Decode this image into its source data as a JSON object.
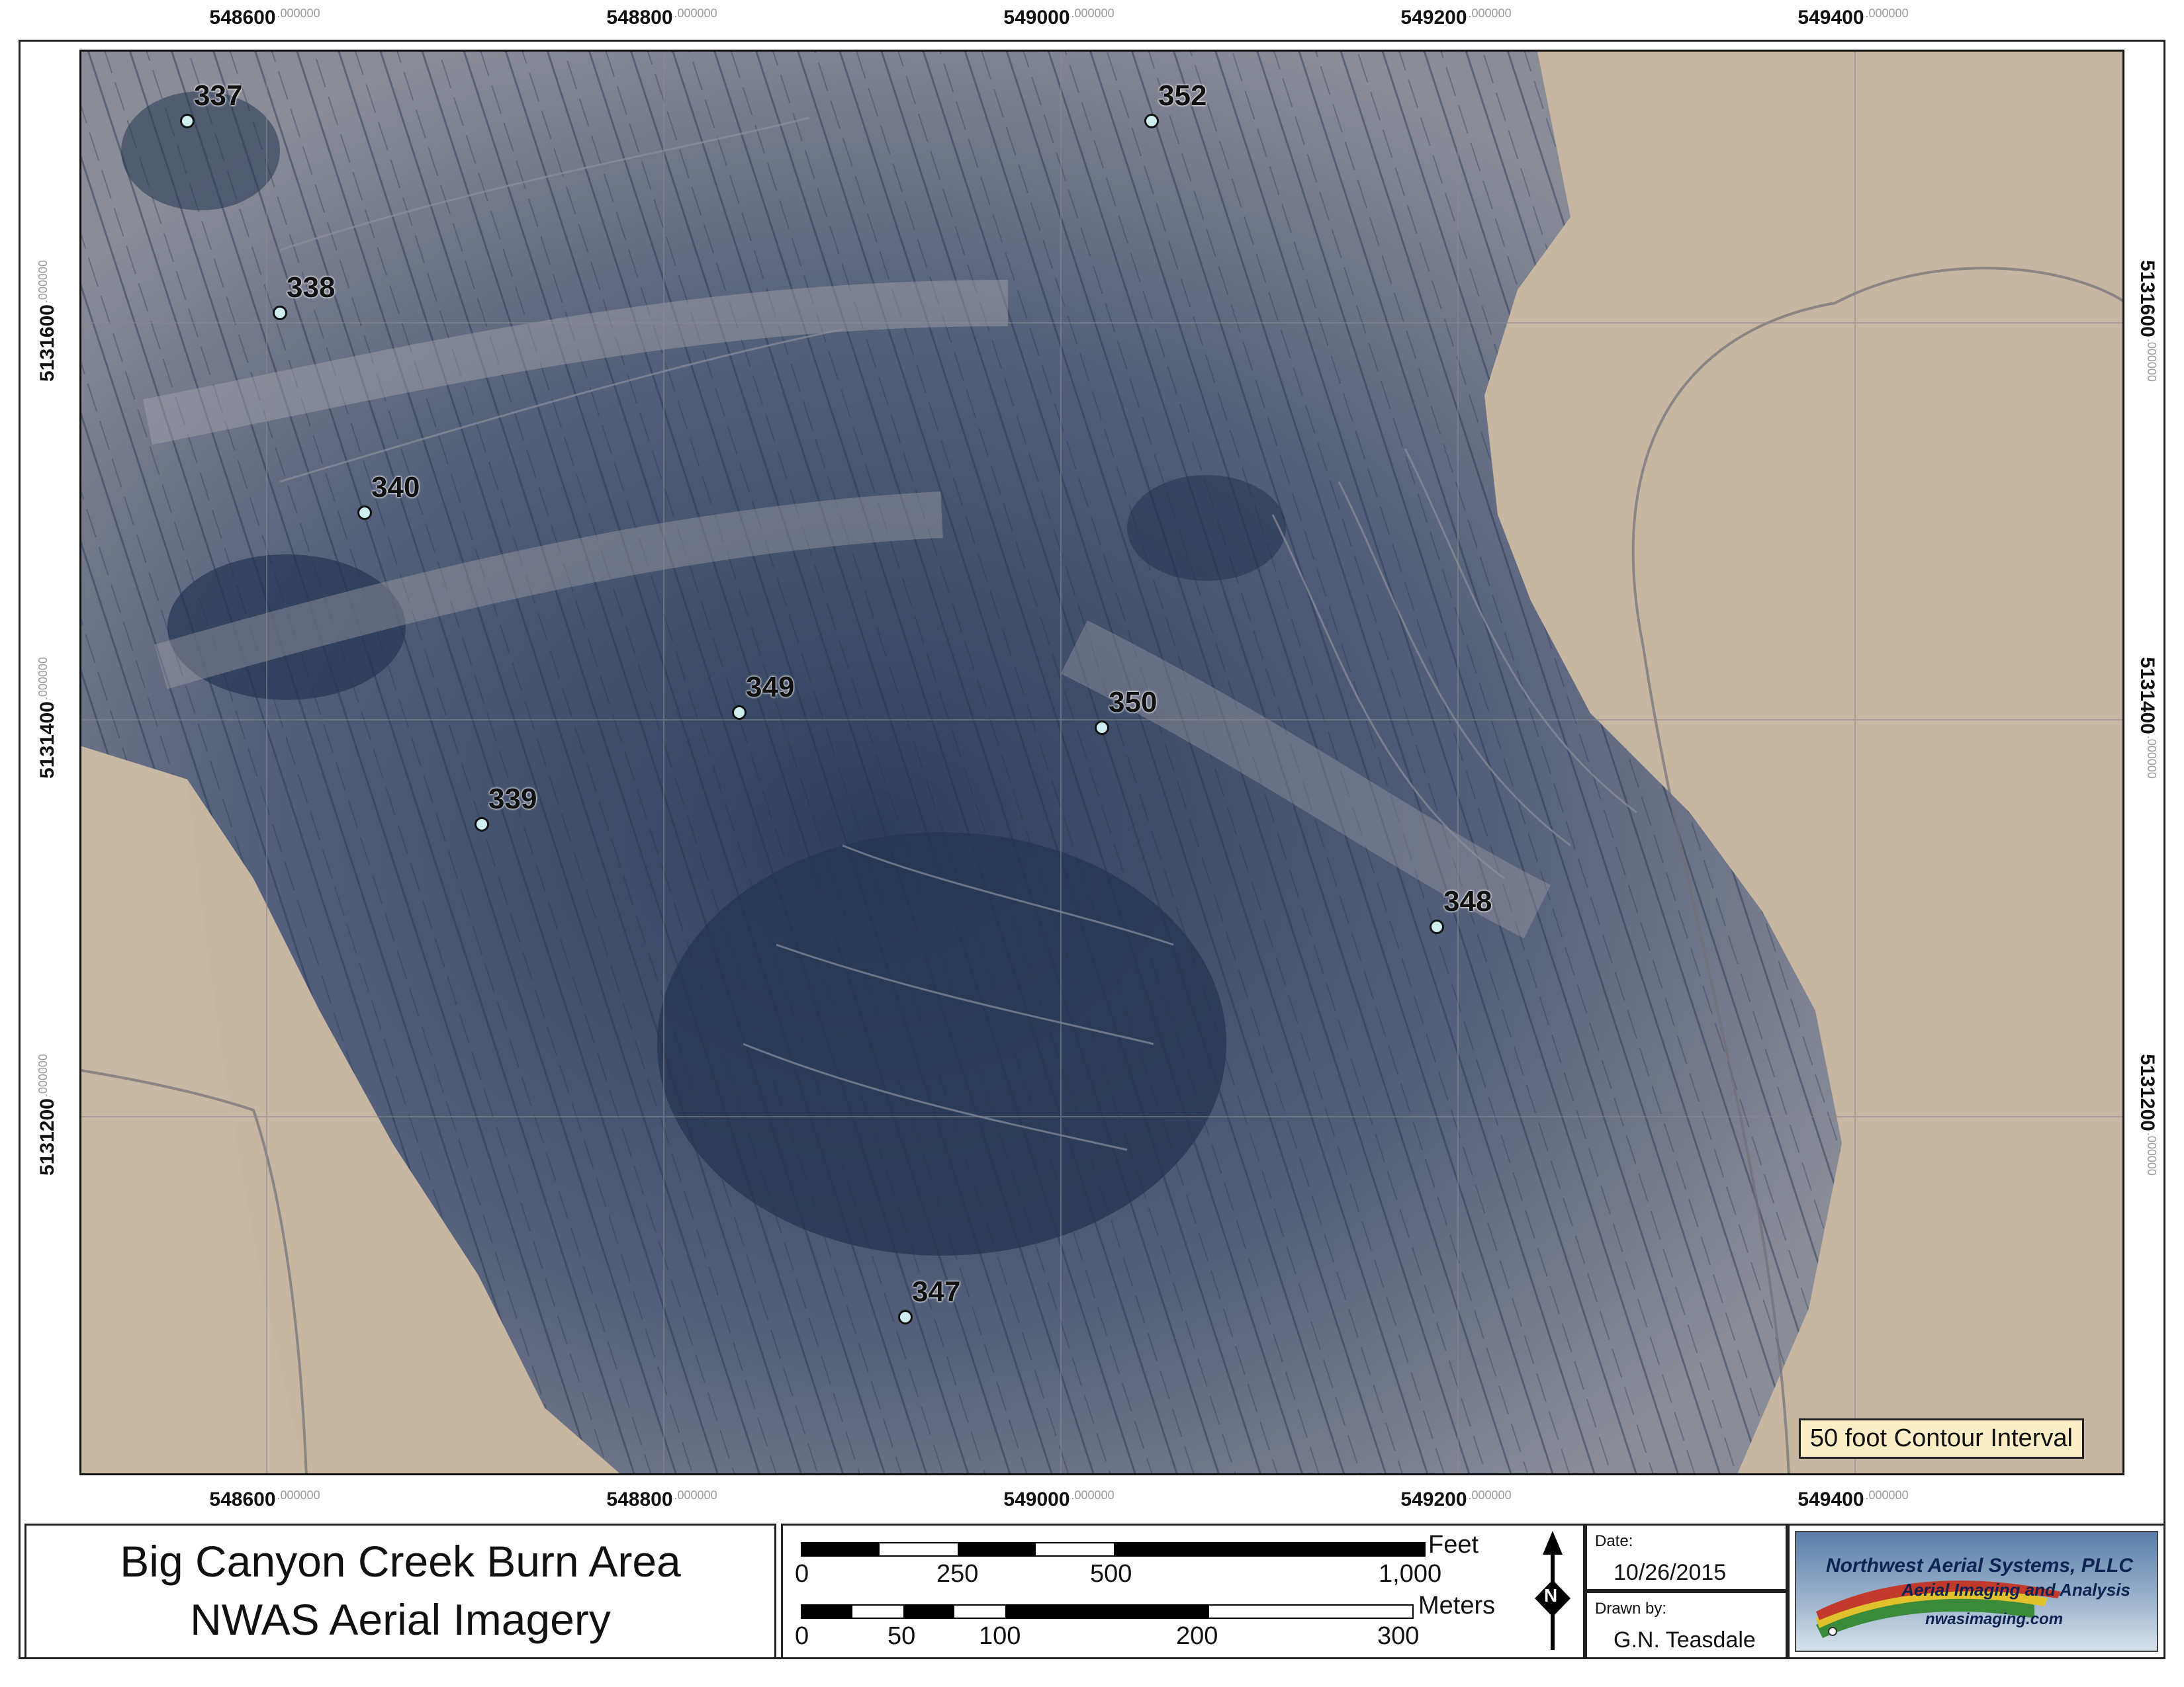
{
  "grid": {
    "easting_ticks": [
      "548600",
      "548800",
      "549000",
      "549200",
      "549400"
    ],
    "northing_ticks": [
      "5131600",
      "5131400",
      "5131200"
    ],
    "decimal_suffix": ".000000"
  },
  "sample_points": [
    {
      "label": "337"
    },
    {
      "label": "338"
    },
    {
      "label": "340"
    },
    {
      "label": "349"
    },
    {
      "label": "339"
    },
    {
      "label": "352"
    },
    {
      "label": "350"
    },
    {
      "label": "348"
    },
    {
      "label": "347"
    }
  ],
  "contour_note": "50 foot Contour Interval",
  "title": {
    "line1": "Big Canyon Creek Burn Area",
    "line2": "NWAS Aerial Imagery"
  },
  "scalebar": {
    "feet_unit": "Feet",
    "feet_ticks": [
      "0",
      "250",
      "500",
      "1,000"
    ],
    "meters_unit": "Meters",
    "meters_ticks": [
      "0",
      "50",
      "100",
      "200",
      "300"
    ]
  },
  "north_arrow": {
    "letter": "N"
  },
  "meta": {
    "date_label": "Date:",
    "date_value": "10/26/2015",
    "drawn_label": "Drawn by:",
    "drawn_value": "G.N. Teasdale"
  },
  "logo": {
    "company": "Northwest Aerial Systems, PLLC",
    "tagline": "Aerial Imaging and Analysis",
    "url": "nwasimaging.com"
  },
  "colors": {
    "field": "#c7b7a2",
    "burn_dark": "#2d3e5c",
    "burn_mid": "#6d7388",
    "point_fill": "#cfeef0"
  }
}
